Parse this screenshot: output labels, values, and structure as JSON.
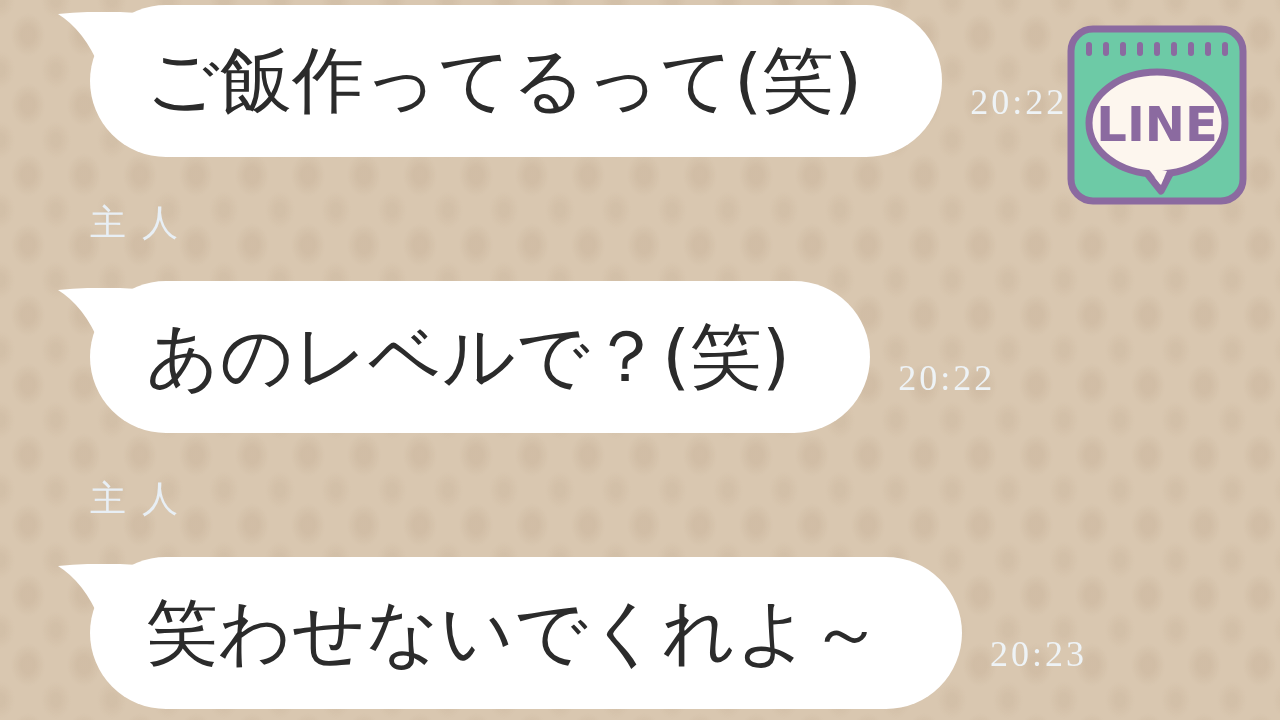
{
  "messages": [
    {
      "text": "ご飯作ってるって(笑)",
      "time": "20:22"
    },
    {
      "sender": "主人",
      "text": "あのレベルで？(笑)",
      "time": "20:22"
    },
    {
      "sender": "主人",
      "text": "笑わせないでくれよ～",
      "time": "20:23"
    }
  ],
  "logo": {
    "text": "LINE"
  }
}
